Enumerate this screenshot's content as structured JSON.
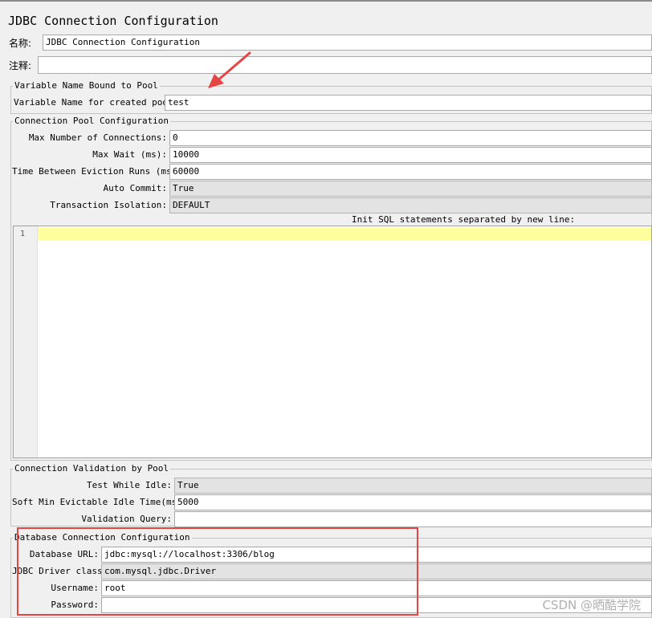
{
  "title": "JDBC Connection Configuration",
  "name_row": {
    "label": "名称:",
    "value": "JDBC Connection Configuration"
  },
  "comment_row": {
    "label": "注释:",
    "value": ""
  },
  "variable_section": {
    "legend": "Variable Name Bound to Pool",
    "label": "Variable Name for created pool:",
    "value": "test"
  },
  "pool_section": {
    "legend": "Connection Pool Configuration",
    "max_connections": {
      "label": "Max Number of Connections:",
      "value": "0"
    },
    "max_wait": {
      "label": "Max Wait (ms):",
      "value": "10000"
    },
    "eviction": {
      "label": "Time Between Eviction Runs (ms):",
      "value": "60000"
    },
    "auto_commit": {
      "label": "Auto Commit:",
      "value": "True"
    },
    "isolation": {
      "label": "Transaction Isolation:",
      "value": "DEFAULT"
    },
    "init_sql_label": "Init SQL statements separated by new line:",
    "editor_line_number": "1"
  },
  "validation_section": {
    "legend": "Connection Validation by Pool",
    "test_while_idle": {
      "label": "Test While Idle:",
      "value": "True"
    },
    "soft_min": {
      "label": "Soft Min Evictable Idle Time(ms):",
      "value": "5000"
    },
    "validation_query": {
      "label": "Validation Query:",
      "value": ""
    }
  },
  "db_section": {
    "legend": "Database Connection Configuration",
    "url": {
      "label": "Database URL:",
      "value": "jdbc:mysql://localhost:3306/blog"
    },
    "driver": {
      "label": "JDBC Driver class:",
      "value": "com.mysql.jdbc.Driver"
    },
    "username": {
      "label": "Username:",
      "value": "root"
    },
    "password": {
      "label": "Password:",
      "value": ""
    }
  },
  "watermark": "CSDN @晒酷学院",
  "annotation_colors": {
    "arrow": "#e64545",
    "box": "#e64545"
  }
}
